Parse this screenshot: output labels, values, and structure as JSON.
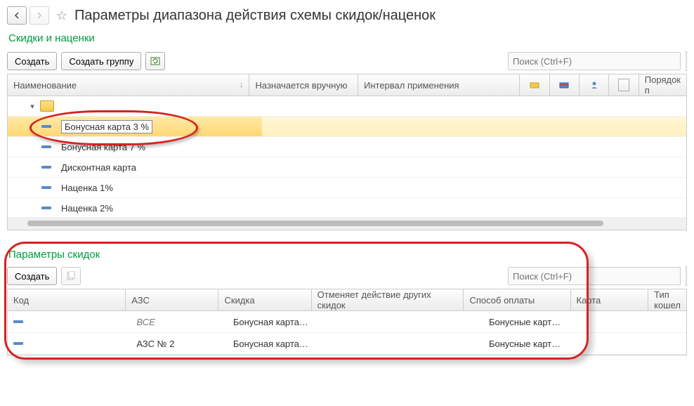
{
  "title": "Параметры диапазона действия схемы скидок/наценок",
  "subtitle": "Скидки и наценки",
  "toolbar": {
    "create": "Создать",
    "create_group": "Создать группу"
  },
  "search_placeholder": "Поиск (Ctrl+F)",
  "grid1": {
    "columns": {
      "name": "Наименование",
      "manual": "Назначается вручную",
      "interval": "Интервал применения",
      "order": "Порядок п"
    },
    "rows": [
      {
        "label": "Бонусная карта 3 %",
        "selected": true
      },
      {
        "label": "Бонусная карта 7 %",
        "selected": false
      },
      {
        "label": "Дисконтная карта",
        "selected": false
      },
      {
        "label": "Наценка 1%",
        "selected": false
      },
      {
        "label": "Наценка 2%",
        "selected": false
      }
    ]
  },
  "section2_title": "Параметры скидок",
  "toolbar2": {
    "create": "Создать"
  },
  "grid2": {
    "columns": {
      "code": "Код",
      "azs": "АЗС",
      "discount": "Скидка",
      "cancels": "Отменяет действие других скидок",
      "payment": "Способ оплаты",
      "card": "Карта",
      "wallet": "Тип кошел"
    },
    "rows": [
      {
        "code": "",
        "azs": "ВСЕ",
        "azs_italic": true,
        "discount": "Бонусная карта…",
        "cancels": "",
        "payment": "Бонусные карт…",
        "card": ""
      },
      {
        "code": "",
        "azs": "АЗС №  2",
        "azs_italic": false,
        "discount": "Бонусная карта…",
        "cancels": "",
        "payment": "Бонусные карт…",
        "card": ""
      }
    ]
  }
}
